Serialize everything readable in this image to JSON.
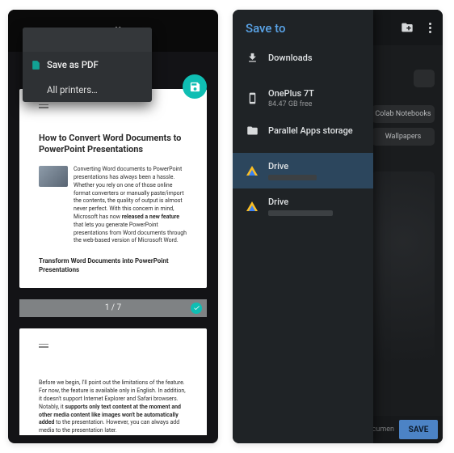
{
  "left": {
    "header_title": "tter",
    "dropdown": {
      "save_pdf": "Save as PDF",
      "all_printers": "All printers…"
    },
    "page1": {
      "heading": "How to Convert Word Documents to PowerPoint Presentations",
      "p1a": "Converting Word documents to PowerPoint presentations has always been a hassle. Whether you rely on one of those online format converters or manually paste/import the contents, the quality of output is almost never perfect. With this concern in mind, Microsoft has now ",
      "p1b": "released a new feature",
      "p1c": " that lets you generate PowerPoint presentations from Word documents through the web-based version of Microsoft Word.",
      "subheading": "Transform Word Documents into PowerPoint Presentations"
    },
    "pager": "1 / 7",
    "page2": {
      "p1a": "Before we begin, I'll point out the limitations of the feature. For now, the feature is available only in English. In addition, it doesn't support Internet Explorer and Safari browsers. Notably, it ",
      "p1b": "supports only text content at the moment and other media content like images won't be automatically added",
      "p1c": " to the presentation. However, you can always add media to the presentation later."
    }
  },
  "right": {
    "title": "Save to",
    "downloads": "Downloads",
    "device_name": "OnePlus 7T",
    "device_free": "84.47 GB free",
    "parallel": "Parallel Apps storage",
    "drive1": "Drive",
    "drive2": "Drive",
    "chip1": "Colab Notebooks",
    "chip2": "Wallpapers",
    "bottom_ghost": "ocumen",
    "save": "SAVE"
  }
}
